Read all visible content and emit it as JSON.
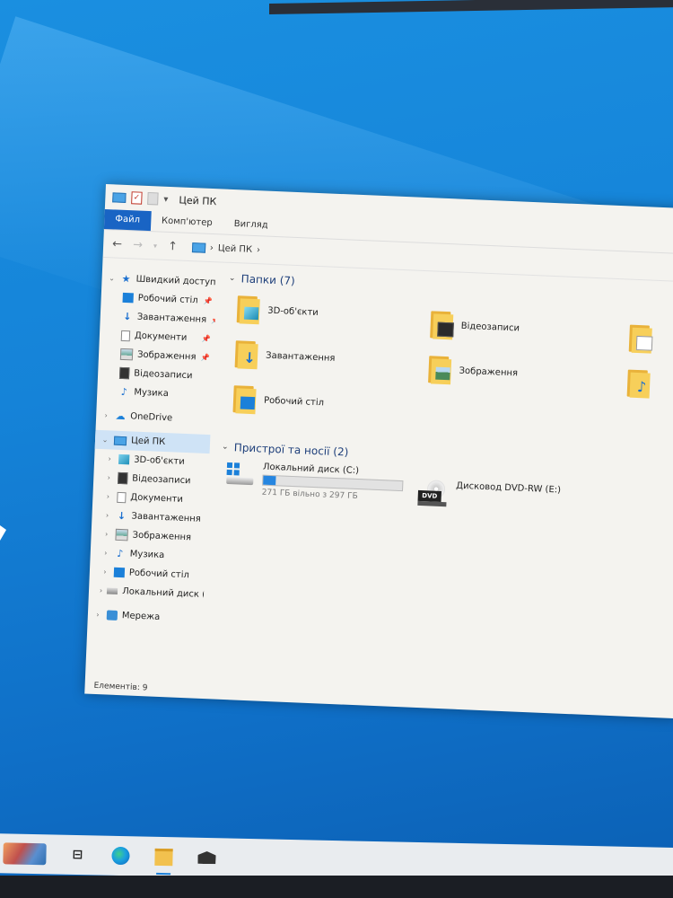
{
  "window": {
    "title": "Цей ПК",
    "ribbon_tabs": [
      "Файл",
      "Комп'ютер",
      "Вигляд"
    ],
    "address": [
      "Цей ПК"
    ]
  },
  "sidebar": {
    "quick_access": {
      "label": "Швидкий доступ",
      "items": [
        "Робочий стіл",
        "Завантаження",
        "Документи",
        "Зображення",
        "Відеозаписи",
        "Музика"
      ]
    },
    "onedrive": "OneDrive",
    "this_pc": {
      "label": "Цей ПК",
      "items": [
        "3D-об'єкти",
        "Відеозаписи",
        "Документи",
        "Завантаження",
        "Зображення",
        "Музика",
        "Робочий стіл",
        "Локальний диск (C"
      ]
    },
    "network": "Мережа"
  },
  "main": {
    "folders_header": "Папки (7)",
    "folders": [
      "3D-об'єкти",
      "Відеозаписи",
      "Завантаження",
      "Зображення",
      "Робочий стіл"
    ],
    "devices_header": "Пристрої та носії (2)",
    "devices": [
      {
        "name": "Локальний диск (C:)",
        "free_text": "271 ГБ вільно з 297 ГБ",
        "used_fraction": 0.088
      },
      {
        "name": "Дисковод DVD-RW (E:)",
        "badge": "DVD"
      }
    ]
  },
  "status": "Елементів: 9",
  "colors": {
    "accent": "#1964c4",
    "desktop": "#1583d8",
    "folder": "#f7cf5a"
  }
}
